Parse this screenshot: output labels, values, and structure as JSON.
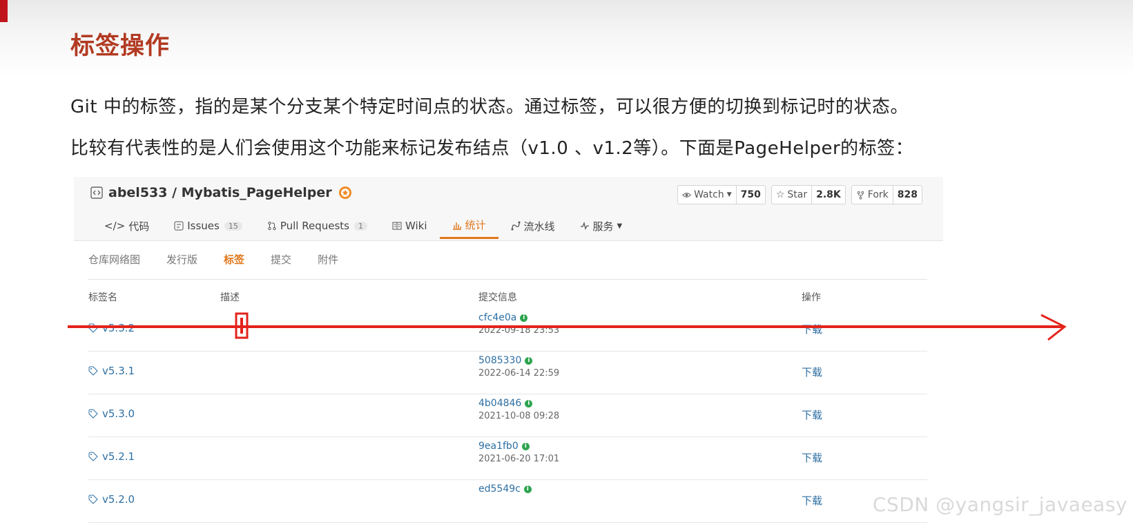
{
  "slide": {
    "title": "标签操作",
    "para1": "Git 中的标签，指的是某个分支某个特定时间点的状态。通过标签，可以很方便的切换到标记时的状态。",
    "para2": "比较有代表性的是人们会使用这个功能来标记发布结点（v1.0 、v1.2等）。下面是PageHelper的标签："
  },
  "repo": {
    "name": "abel533 / Mybatis_PageHelper",
    "watch_label": "Watch",
    "watch_count": "750",
    "star_label": "Star",
    "star_count": "2.8K",
    "fork_label": "Fork",
    "fork_count": "828",
    "nav": {
      "code": "代码",
      "issues": "Issues",
      "issues_count": "15",
      "pulls": "Pull Requests",
      "pulls_count": "1",
      "wiki": "Wiki",
      "stats": "统计",
      "pipeline": "流水线",
      "services": "服务"
    }
  },
  "subtabs": {
    "network": "仓库网络图",
    "releases": "发行版",
    "tags": "标签",
    "commits": "提交",
    "attachments": "附件"
  },
  "table": {
    "headers": {
      "name": "标签名",
      "description": "描述",
      "commit": "提交信息",
      "action": "操作"
    },
    "rows": [
      {
        "tag": "v5.3.2",
        "sha": "cfc4e0a",
        "date": "2022-09-18 23:53",
        "action": "下载"
      },
      {
        "tag": "v5.3.1",
        "sha": "5085330",
        "date": "2022-06-14 22:59",
        "action": "下载"
      },
      {
        "tag": "v5.3.0",
        "sha": "4b04846",
        "date": "2021-10-08 09:28",
        "action": "下载"
      },
      {
        "tag": "v5.2.1",
        "sha": "9ea1fb0",
        "date": "2021-06-20 17:01",
        "action": "下载"
      },
      {
        "tag": "v5.2.0",
        "sha": "ed5549c",
        "date": "",
        "action": "下载"
      }
    ]
  },
  "colors": {
    "accent": "#e0771c",
    "title_red": "#b23a22",
    "link": "#2d6fa3",
    "annotation_red": "#e3231b"
  },
  "watermark": "CSDN @yangsir_javaeasy"
}
